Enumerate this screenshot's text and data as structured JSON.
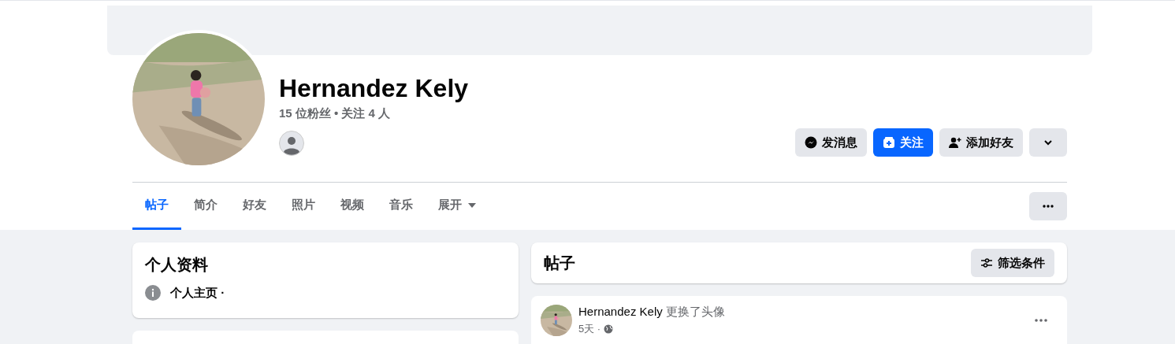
{
  "profile": {
    "name": "Hernandez Kely",
    "stats": "15 位粉丝 • 关注 4 人"
  },
  "actions": [
    {
      "label": "发消息",
      "kind": "message"
    },
    {
      "label": "关注",
      "kind": "follow"
    },
    {
      "label": "添加好友",
      "kind": "add_friend"
    },
    {
      "kind": "more"
    }
  ],
  "tabs": [
    {
      "label": "帖子",
      "selected": true,
      "has_menu": false
    },
    {
      "label": "简介",
      "selected": false,
      "has_menu": false
    },
    {
      "label": "好友",
      "selected": false,
      "has_menu": false
    },
    {
      "label": "照片",
      "selected": false,
      "has_menu": false
    },
    {
      "label": "视频",
      "selected": false,
      "has_menu": false
    },
    {
      "label": "音乐",
      "selected": false,
      "has_menu": false
    },
    {
      "label": "展开",
      "selected": false,
      "has_menu": true
    }
  ],
  "intro": {
    "title": "个人资料",
    "items": [
      {
        "text": "个人主页 ·"
      }
    ]
  },
  "posts_header": {
    "title": "帖子",
    "filter_button": "筛选条件"
  },
  "post": {
    "author": "Hernandez Kely",
    "action": "更换了头像",
    "time": "5天 ·"
  }
}
